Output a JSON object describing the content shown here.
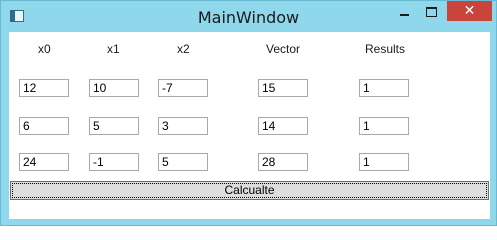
{
  "window": {
    "title": "MainWindow",
    "close_glyph": "✕"
  },
  "headers": [
    "x0",
    "x1",
    "x2",
    "Vector",
    "Results"
  ],
  "rows": [
    [
      "12",
      "10",
      "-7",
      "15",
      "1"
    ],
    [
      "6",
      "5",
      "3",
      "14",
      "1"
    ],
    [
      "24",
      "-1",
      "5",
      "28",
      "1"
    ]
  ],
  "calculate_label": "Calcualte"
}
